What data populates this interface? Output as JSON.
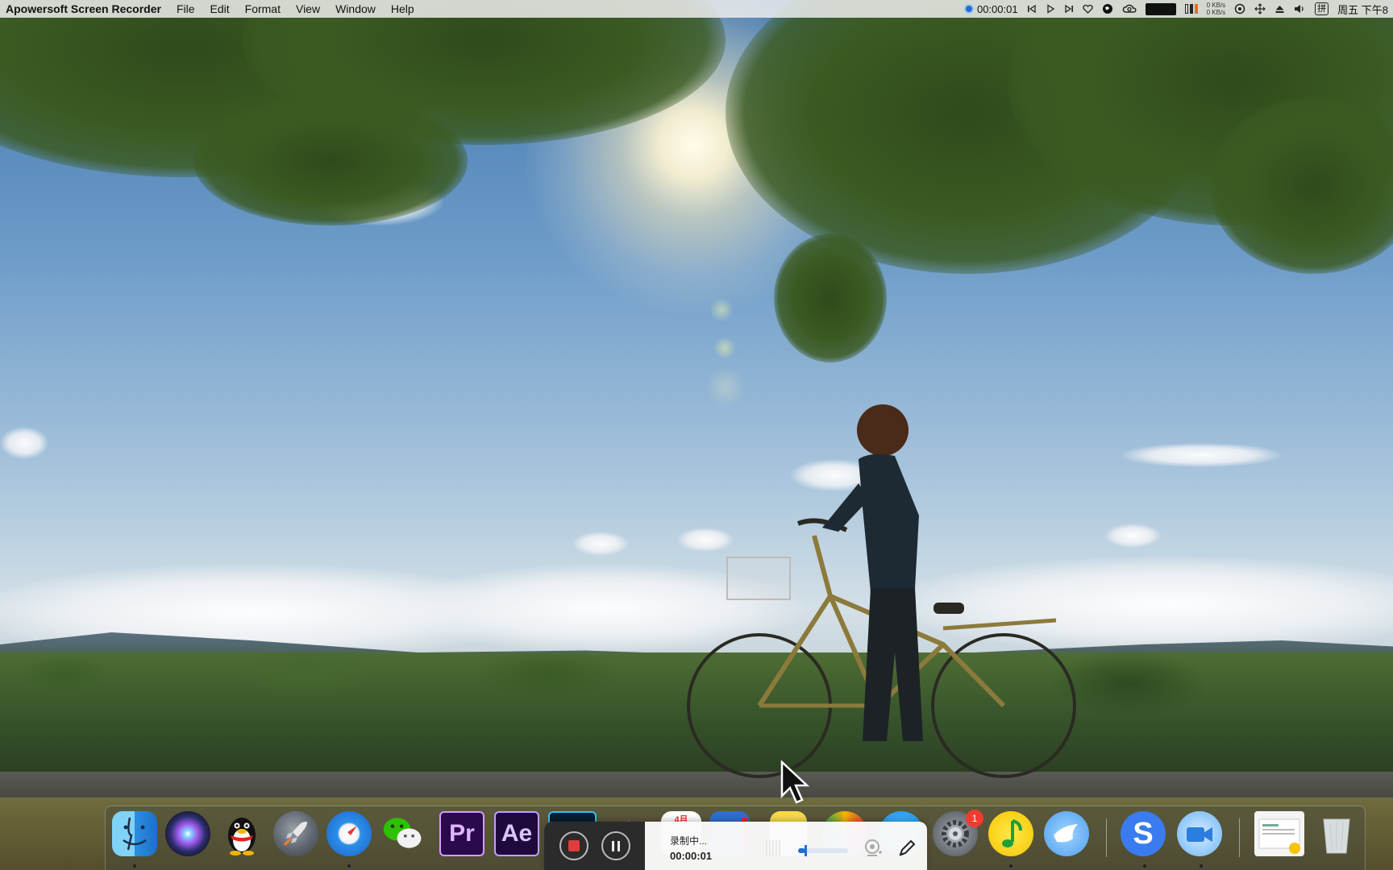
{
  "menubar": {
    "app_name": "Apowersoft Screen Recorder",
    "menus": [
      "File",
      "Edit",
      "Format",
      "View",
      "Window",
      "Help"
    ],
    "record_time": "00:00:01",
    "net_up": "0 KB/s",
    "net_down": "0 KB/s",
    "input_method": "拼",
    "clock": "周五 下午8"
  },
  "dock": {
    "apps": [
      {
        "name": "Finder",
        "icon": "finder-icon"
      },
      {
        "name": "Siri",
        "icon": "siri-icon"
      },
      {
        "name": "QQ",
        "icon": "qq-penguin-icon"
      },
      {
        "name": "Launchpad",
        "icon": "rocket-icon"
      },
      {
        "name": "Safari",
        "icon": "compass-icon"
      },
      {
        "name": "WeChat",
        "icon": "wechat-icon",
        "label": ""
      },
      {
        "name": "Premiere Pro",
        "icon": "premiere-icon",
        "label": "Pr"
      },
      {
        "name": "After Effects",
        "icon": "after-effects-icon",
        "label": "Ae"
      },
      {
        "name": "Photoshop",
        "icon": "photoshop-icon",
        "label": "P"
      },
      {
        "name": "Calendar",
        "icon": "calendar-icon",
        "label": "4月"
      },
      {
        "name": "System Preferences",
        "icon": "gear-icon",
        "badge": "1"
      },
      {
        "name": "QQ Music",
        "icon": "music-note-icon"
      },
      {
        "name": "Feishu",
        "icon": "bird-icon"
      },
      {
        "name": "Sogou",
        "icon": "s-icon",
        "label": "S"
      },
      {
        "name": "Apowersoft",
        "icon": "video-camera-icon"
      },
      {
        "name": "Preview",
        "icon": "preview-icon"
      },
      {
        "name": "Trash",
        "icon": "trash-icon"
      }
    ]
  },
  "recorder": {
    "status": "录制中...",
    "timer": "00:00:01",
    "volume": 0.15
  },
  "colors": {
    "accent": "#1f6fd1",
    "stop_red": "#e03c3c",
    "premiere_purple": "#2a0a4a",
    "badge_red": "#f23b30"
  }
}
